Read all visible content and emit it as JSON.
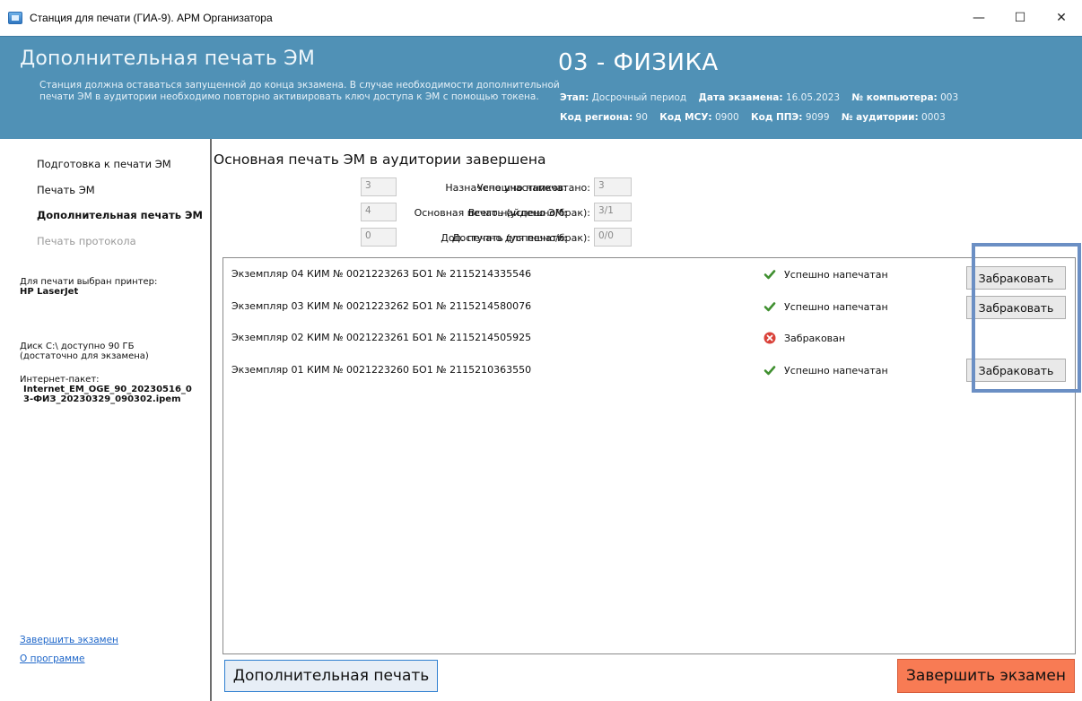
{
  "window": {
    "title": "Станция для печати (ГИА-9). АРМ Организатора",
    "minimize": "—",
    "maximize": "☐",
    "close": "✕"
  },
  "header": {
    "title": "Дополнительная печать ЭМ",
    "description": "Станция должна оставаться запущенной до конца экзамена. В случае необходимости дополнительной печати ЭМ в аудитории необходимо повторно активировать ключ доступа к ЭМ с помощью токена.",
    "subject": "03 - ФИЗИКА",
    "stage_label": "Этап:",
    "stage_value": "Досрочный период",
    "exam_date_label": "Дата экзамена:",
    "exam_date_value": "16.05.2023",
    "computer_label": "№ компьютера:",
    "computer_value": "003",
    "region_label": "Код региона:",
    "region_value": "90",
    "msu_label": "Код МСУ:",
    "msu_value": "0900",
    "ppe_label": "Код ППЭ:",
    "ppe_value": "9099",
    "room_label": "№ аудитории:",
    "room_value": "0003"
  },
  "sidebar": {
    "nav": [
      {
        "label": "Подготовка к печати ЭМ",
        "state": "normal"
      },
      {
        "label": "Печать ЭМ",
        "state": "normal"
      },
      {
        "label": "Дополнительная печать ЭМ",
        "state": "active"
      },
      {
        "label": "Печать протокола",
        "state": "disabled"
      }
    ],
    "printer_label": "Для печати выбран принтер:",
    "printer_value": "HP LaserJet",
    "disk_line1": "Диск C:\\ доступно 90 ГБ",
    "disk_line2": "(достаточно для экзамена)",
    "package_label": "Интернет-пакет:",
    "package_line1": "Internet_EM_OGE_90_20230516_0",
    "package_line2": "3-ФИЗ_20230329_090302.ipem",
    "finish_link": "Завершить экзамен",
    "about_link": "О программе"
  },
  "main": {
    "title": "Основная печать ЭМ в аудитории завершена",
    "stats": {
      "assigned_label": "Назначено участников:",
      "assigned_value": "3",
      "found_label": "Всего найдено ЭМ:",
      "found_value": "4",
      "available_label": "Доступно для печати:",
      "available_value": "0",
      "printed_label": "Успешно напечатано:",
      "printed_value": "3",
      "main_print_label": "Основная печать (успешно/брак):",
      "main_print_value": "3/1",
      "extra_print_label": "Доп. печать (успешно/брак):",
      "extra_print_value": "0/0"
    },
    "rows": [
      {
        "text": "Экземпляр 04  КИМ № 0021223263  БО1 № 2115214335546",
        "status": "Успешно напечатан",
        "ok": true,
        "button": "Забраковать"
      },
      {
        "text": "Экземпляр 03  КИМ № 0021223262  БО1 № 2115214580076",
        "status": "Успешно напечатан",
        "ok": true,
        "button": "Забраковать"
      },
      {
        "text": "Экземпляр 02  КИМ № 0021223261  БО1 № 2115214505925",
        "status": "Забракован",
        "ok": false,
        "button": ""
      },
      {
        "text": "Экземпляр 01  КИМ № 0021223260  БО1 № 2115210363550",
        "status": "Успешно напечатан",
        "ok": true,
        "button": "Забраковать"
      }
    ],
    "extra_print_button": "Дополнительная печать",
    "finish_button": "Завершить экзамен"
  },
  "colors": {
    "header_bg": "#5091b6",
    "ok_green": "#3f8f2f",
    "reject_red": "#d9423a",
    "finish_bg": "#f87b54",
    "highlight_border": "#6b8fc4"
  }
}
